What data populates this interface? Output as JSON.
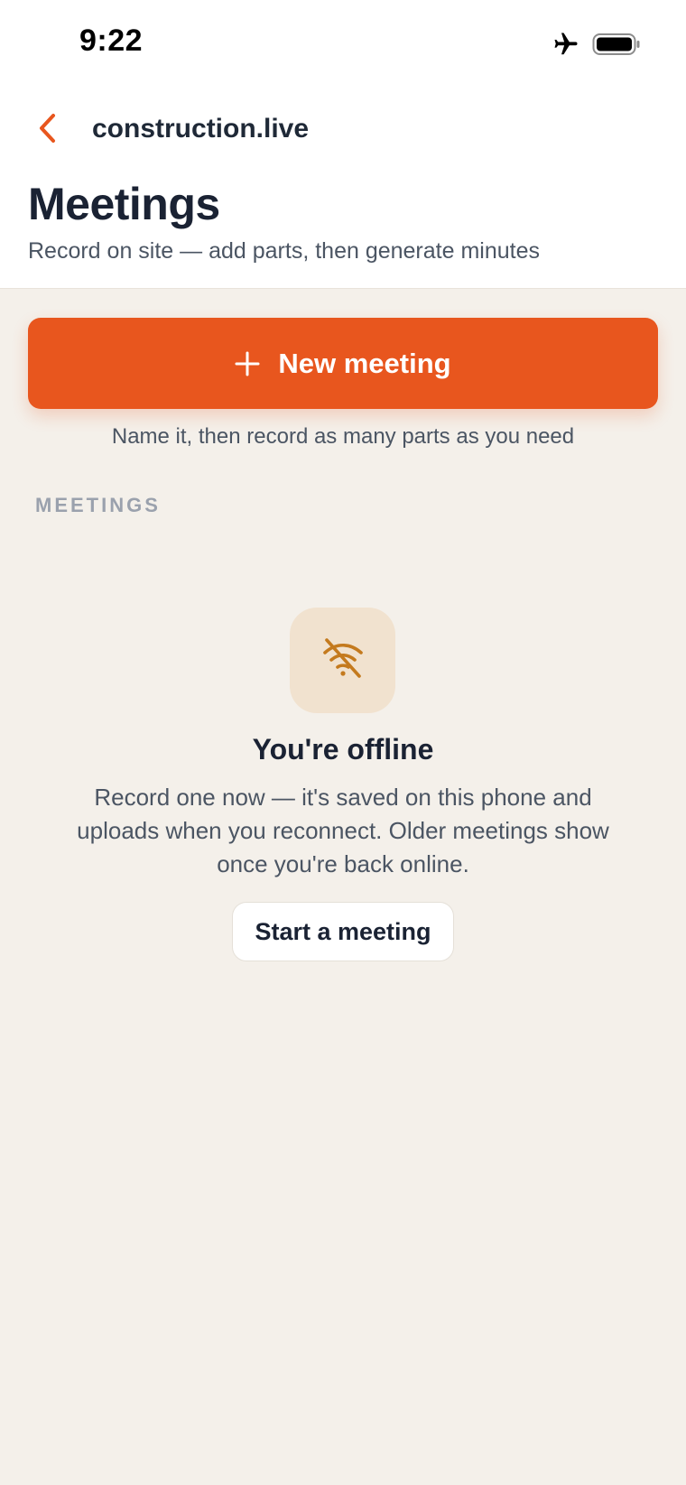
{
  "status_bar": {
    "time": "9:22",
    "icons": [
      "airplane-icon",
      "battery-icon"
    ]
  },
  "nav": {
    "back_icon": "chevron-left-icon",
    "title": "construction.live"
  },
  "header": {
    "title": "Meetings",
    "subtitle": "Record on site — add parts, then generate minutes"
  },
  "new_meeting": {
    "label": "New meeting",
    "icon": "plus-icon",
    "hint": "Name it, then record as many parts as you need"
  },
  "section": {
    "label": "MEETINGS"
  },
  "empty_state": {
    "icon": "wifi-off-icon",
    "title": "You're offline",
    "body": "Record one now — it's saved on this phone and uploads when you reconnect. Older meetings show once you're back online.",
    "button_label": "Start a meeting"
  },
  "colors": {
    "accent": "#e8561e",
    "background": "#f4f0ea",
    "offline_icon": "#c47a1e",
    "offline_icon_bg": "#f1e2cf"
  }
}
